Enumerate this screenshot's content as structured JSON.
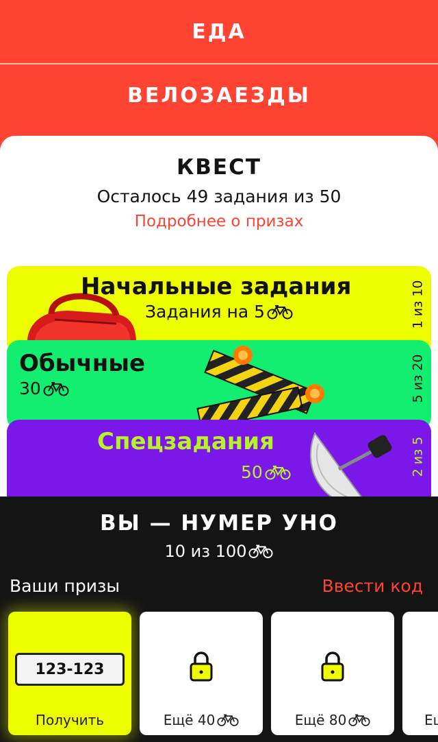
{
  "menu": {
    "food_label": "ЕДА",
    "rides_label": "ВЕЛОЗАЕЗДЫ"
  },
  "quest": {
    "title": "КВЕСТ",
    "remaining": "Осталось 49 задания из 50",
    "prizes_link": "Подробнее о призах"
  },
  "tasks": [
    {
      "title": "Начальные задания",
      "subtitle": "Задания на 5",
      "count": "1 из 10",
      "color": "#eefc00",
      "illustration": "red-bag"
    },
    {
      "title": "Обычные",
      "subtitle": "30",
      "count": "5 из 20",
      "color": "#14ee70",
      "illustration": "road-barrier"
    },
    {
      "title": "Спецзадания",
      "subtitle": "50",
      "count": "2 из 5",
      "color": "#7b17e8",
      "accent": "#b7f22a",
      "illustration": "satellite-dish"
    }
  ],
  "rank": {
    "title": "ВЫ — НУМЕР УНО",
    "progress": "10 из 100"
  },
  "prizes": {
    "label": "Ваши призы",
    "enter_code": "Ввести код",
    "items": [
      {
        "code": "123-123",
        "caption": "Получить",
        "state": "unlocked"
      },
      {
        "caption": "Ещё 40",
        "state": "locked"
      },
      {
        "caption": "Ещё 80",
        "state": "locked"
      },
      {
        "caption": "Ещ",
        "state": "locked"
      }
    ]
  },
  "colors": {
    "brand_red": "#ff4333",
    "accent_yellow": "#eefc00",
    "accent_green": "#14ee70",
    "accent_purple": "#7b17e8",
    "dark": "#141414"
  },
  "icons": [
    "bicycle-icon",
    "lock-icon"
  ]
}
